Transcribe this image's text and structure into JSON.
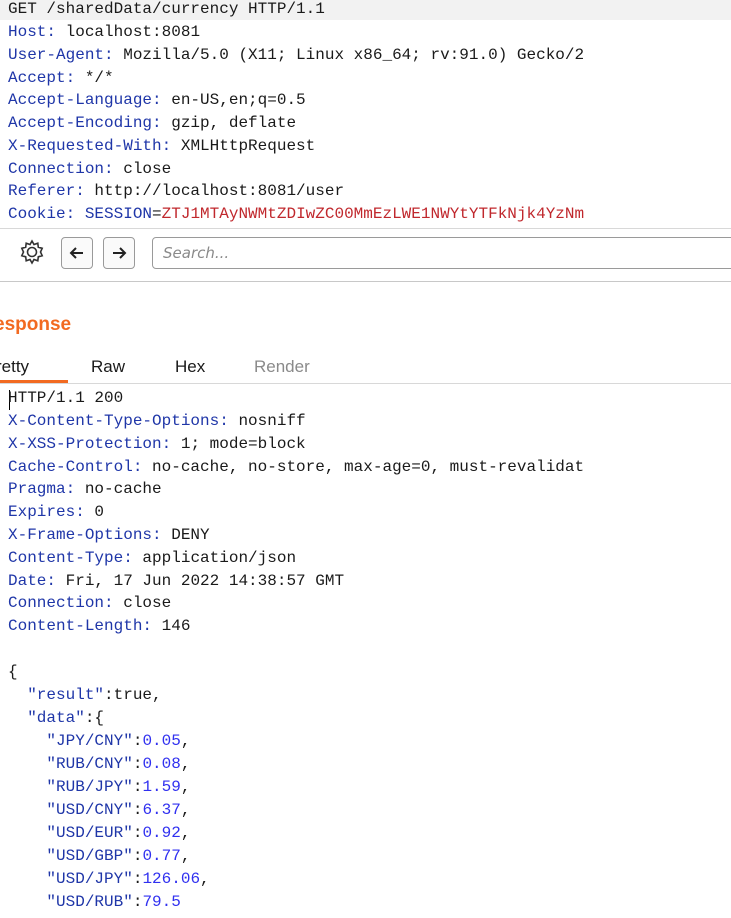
{
  "request": {
    "request_line": "GET /sharedData/currency HTTP/1.1",
    "headers": [
      {
        "name": "Host:",
        "value": " localhost:8081"
      },
      {
        "name": "User-Agent:",
        "value": " Mozilla/5.0 (X11; Linux x86_64; rv:91.0) Gecko/2"
      },
      {
        "name": "Accept:",
        "value": " */*"
      },
      {
        "name": "Accept-Language:",
        "value": " en-US,en;q=0.5"
      },
      {
        "name": "Accept-Encoding:",
        "value": " gzip, deflate"
      },
      {
        "name": "X-Requested-With:",
        "value": " XMLHttpRequest"
      },
      {
        "name": "Connection:",
        "value": " close"
      },
      {
        "name": "Referer:",
        "value": " http://localhost:8081/user"
      }
    ],
    "cookie": {
      "label": "Cookie:",
      "name": " SESSION",
      "eq": "=",
      "value": "ZTJ1MTAyNWMtZDIwZC00MmEzLWE1NWYtYTFkNjk4YzNm"
    }
  },
  "toolbar": {
    "search_placeholder": "Search..."
  },
  "response": {
    "title": "esponse",
    "tabs": [
      {
        "label": "retty",
        "active": true
      },
      {
        "label": "Raw",
        "active": false
      },
      {
        "label": "Hex",
        "active": false
      },
      {
        "label": "Render",
        "active": false
      }
    ],
    "status_line": "HTTP/1.1 200",
    "headers": [
      {
        "name": "X-Content-Type-Options:",
        "value": " nosniff"
      },
      {
        "name": "X-XSS-Protection:",
        "value": " 1; mode=block"
      },
      {
        "name": "Cache-Control:",
        "value": " no-cache, no-store, max-age=0, must-revalidat"
      },
      {
        "name": "Pragma:",
        "value": " no-cache"
      },
      {
        "name": "Expires:",
        "value": " 0"
      },
      {
        "name": "X-Frame-Options:",
        "value": " DENY"
      },
      {
        "name": "Content-Type:",
        "value": " application/json"
      },
      {
        "name": "Date:",
        "value": " Fri, 17 Jun 2022 14:38:57 GMT"
      },
      {
        "name": "Connection:",
        "value": " close"
      },
      {
        "name": "Content-Length:",
        "value": " 146"
      }
    ],
    "body": {
      "open_brace": "{",
      "result_key": "  \"result\"",
      "result_sep": ":",
      "result_value": "true,",
      "data_key": "  \"data\"",
      "data_sep": ":{",
      "rates": [
        {
          "key": "    \"JPY/CNY\"",
          "value": "0.05",
          "tail": ","
        },
        {
          "key": "    \"RUB/CNY\"",
          "value": "0.08",
          "tail": ","
        },
        {
          "key": "    \"RUB/JPY\"",
          "value": "1.59",
          "tail": ","
        },
        {
          "key": "    \"USD/CNY\"",
          "value": "6.37",
          "tail": ","
        },
        {
          "key": "    \"USD/EUR\"",
          "value": "0.92",
          "tail": ","
        },
        {
          "key": "    \"USD/GBP\"",
          "value": "0.77",
          "tail": ","
        },
        {
          "key": "    \"USD/JPY\"",
          "value": "126.06",
          "tail": ","
        },
        {
          "key": "    \"USD/RUB\"",
          "value": "79.5",
          "tail": ""
        }
      ]
    }
  },
  "colors": {
    "accent": "#f26a21",
    "header_name": "#1f36a8",
    "cookie_value": "#c0282d",
    "json_number": "#3030f0"
  }
}
